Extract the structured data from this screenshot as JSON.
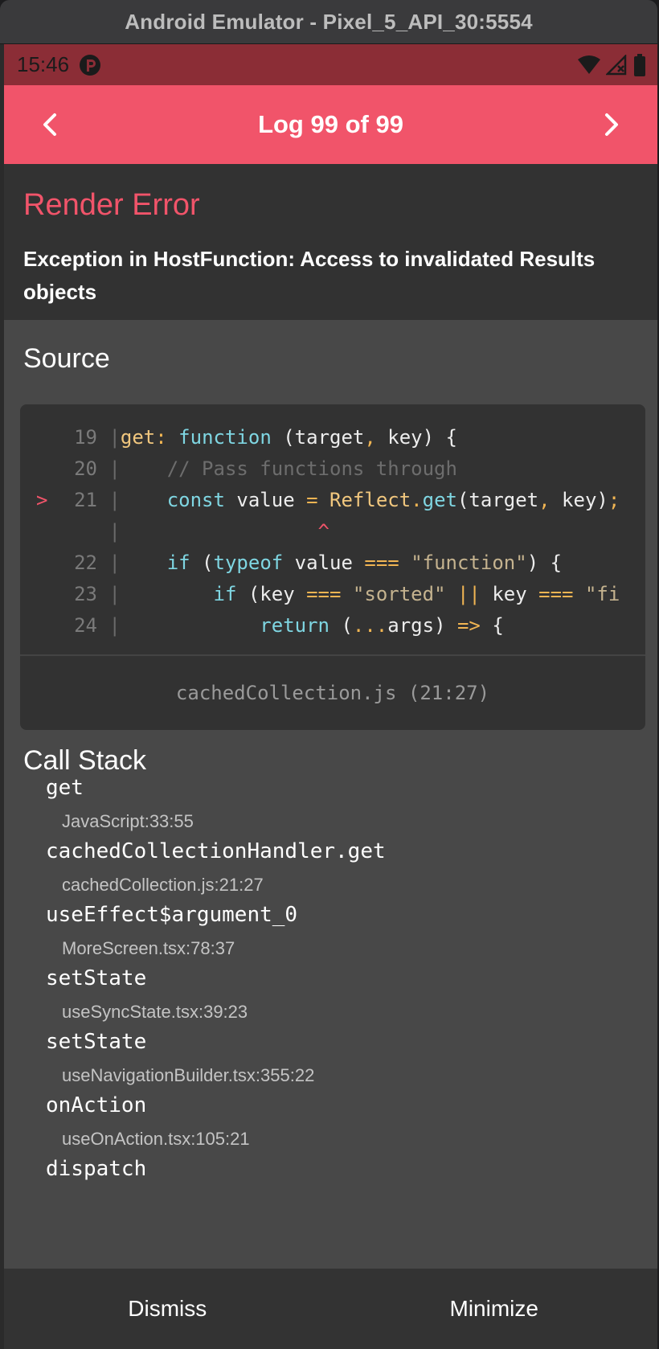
{
  "window": {
    "title": "Android Emulator - Pixel_5_API_30:5554"
  },
  "status_bar": {
    "time": "15:46",
    "icons": [
      "app-notification-icon",
      "wifi-icon",
      "signal-icon",
      "battery-icon"
    ]
  },
  "header": {
    "title": "Log 99 of 99",
    "prev_icon": "chevron-left-icon",
    "next_icon": "chevron-right-icon"
  },
  "error": {
    "title": "Render Error",
    "message": "Exception in HostFunction: Access to invalidated Results objects"
  },
  "source": {
    "heading": "Source",
    "file": "cachedCollection.js (21:27)",
    "lines": [
      {
        "num": "19",
        "text": "get: function (target, key) {"
      },
      {
        "num": "20",
        "text": "    // Pass functions through"
      },
      {
        "num": "21",
        "text": "    const value = Reflect.get(target, key);",
        "highlight": true
      },
      {
        "num": "",
        "text": "                 ^"
      },
      {
        "num": "22",
        "text": "    if (typeof value === \"function\") {"
      },
      {
        "num": "23",
        "text": "        if (key === \"sorted\" || key === \"fi"
      },
      {
        "num": "24",
        "text": "            return (...args) => {"
      }
    ]
  },
  "call_stack": {
    "heading": "Call Stack",
    "frames": [
      {
        "name": "get",
        "location": "JavaScript:33:55"
      },
      {
        "name": "cachedCollectionHandler.get",
        "location": "cachedCollection.js:21:27"
      },
      {
        "name": "useEffect$argument_0",
        "location": "MoreScreen.tsx:78:37"
      },
      {
        "name": "setState",
        "location": "useSyncState.tsx:39:23"
      },
      {
        "name": "setState",
        "location": "useNavigationBuilder.tsx:355:22"
      },
      {
        "name": "onAction",
        "location": "useOnAction.tsx:105:21"
      },
      {
        "name": "dispatch",
        "location": ""
      }
    ]
  },
  "actions": {
    "dismiss": "Dismiss",
    "minimize": "Minimize"
  },
  "colors": {
    "accent": "#f1546a",
    "status_bar": "#8b2d36",
    "background": "#484848",
    "panel": "#323232"
  }
}
